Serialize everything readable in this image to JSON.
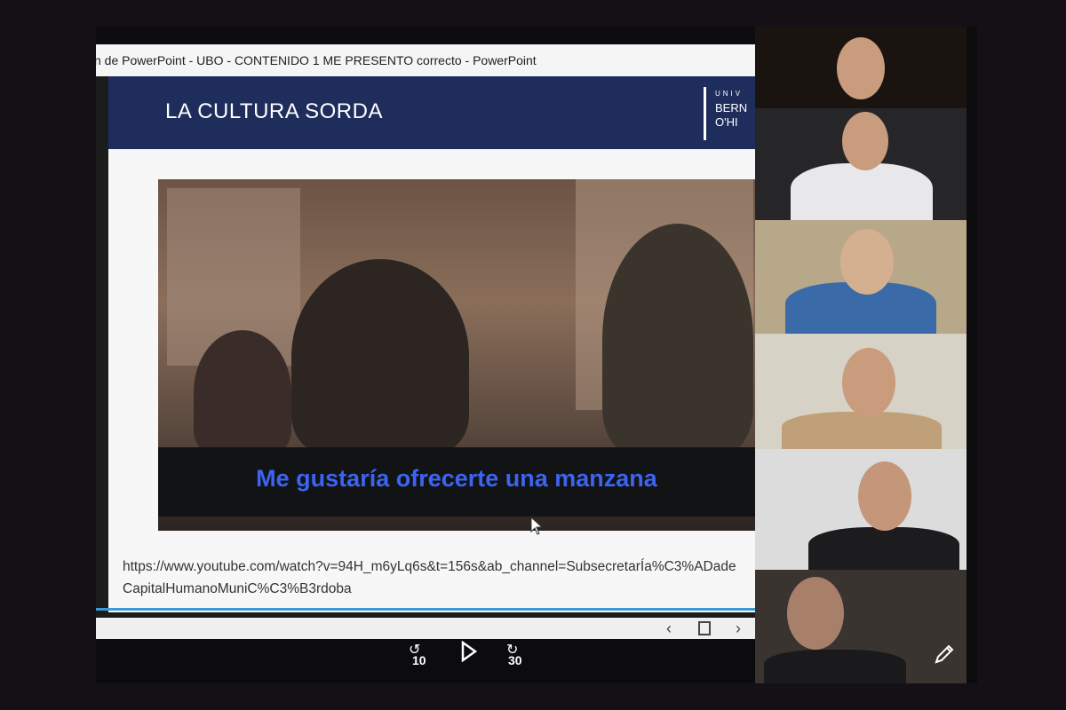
{
  "window": {
    "title": "n de PowerPoint  -  UBO - CONTENIDO 1 ME PRESENTO correcto - PowerPoint"
  },
  "slide": {
    "title": "LA CULTURA SORDA",
    "logo_line1": "UNIV",
    "logo_line2": "BERN",
    "logo_line3": "O'HI",
    "video_subtitle": "Me gustaría ofrecerte una manzana",
    "link": "https://www.youtube.com/watch?v=94H_m6yLq6s&t=156s&ab_channel=SubsecretarÍa%C3%ADadeCapitalHumanoMuniC%C3%B3rdoba"
  },
  "status_bar": {
    "prev_icon": "chevron-left-icon",
    "notes_icon": "notes-icon",
    "next_icon": "chevron-right-icon"
  },
  "playback": {
    "rewind_label": "10",
    "forward_label": "30",
    "play_icon": "play-icon"
  },
  "participants": [
    {
      "id": "participant-1",
      "bg": "#1a1410"
    },
    {
      "id": "participant-2",
      "bg": "#262628"
    },
    {
      "id": "participant-3",
      "bg": "#b8a88a"
    },
    {
      "id": "participant-4",
      "bg": "#d6d2c6"
    },
    {
      "id": "participant-5",
      "bg": "#dcdcdc"
    },
    {
      "id": "participant-6",
      "bg": "#3a3430"
    }
  ],
  "colors": {
    "slide_header": "#1e2d5c",
    "subtitle": "#3c64f0",
    "accent_line": "#3a9ad9"
  }
}
